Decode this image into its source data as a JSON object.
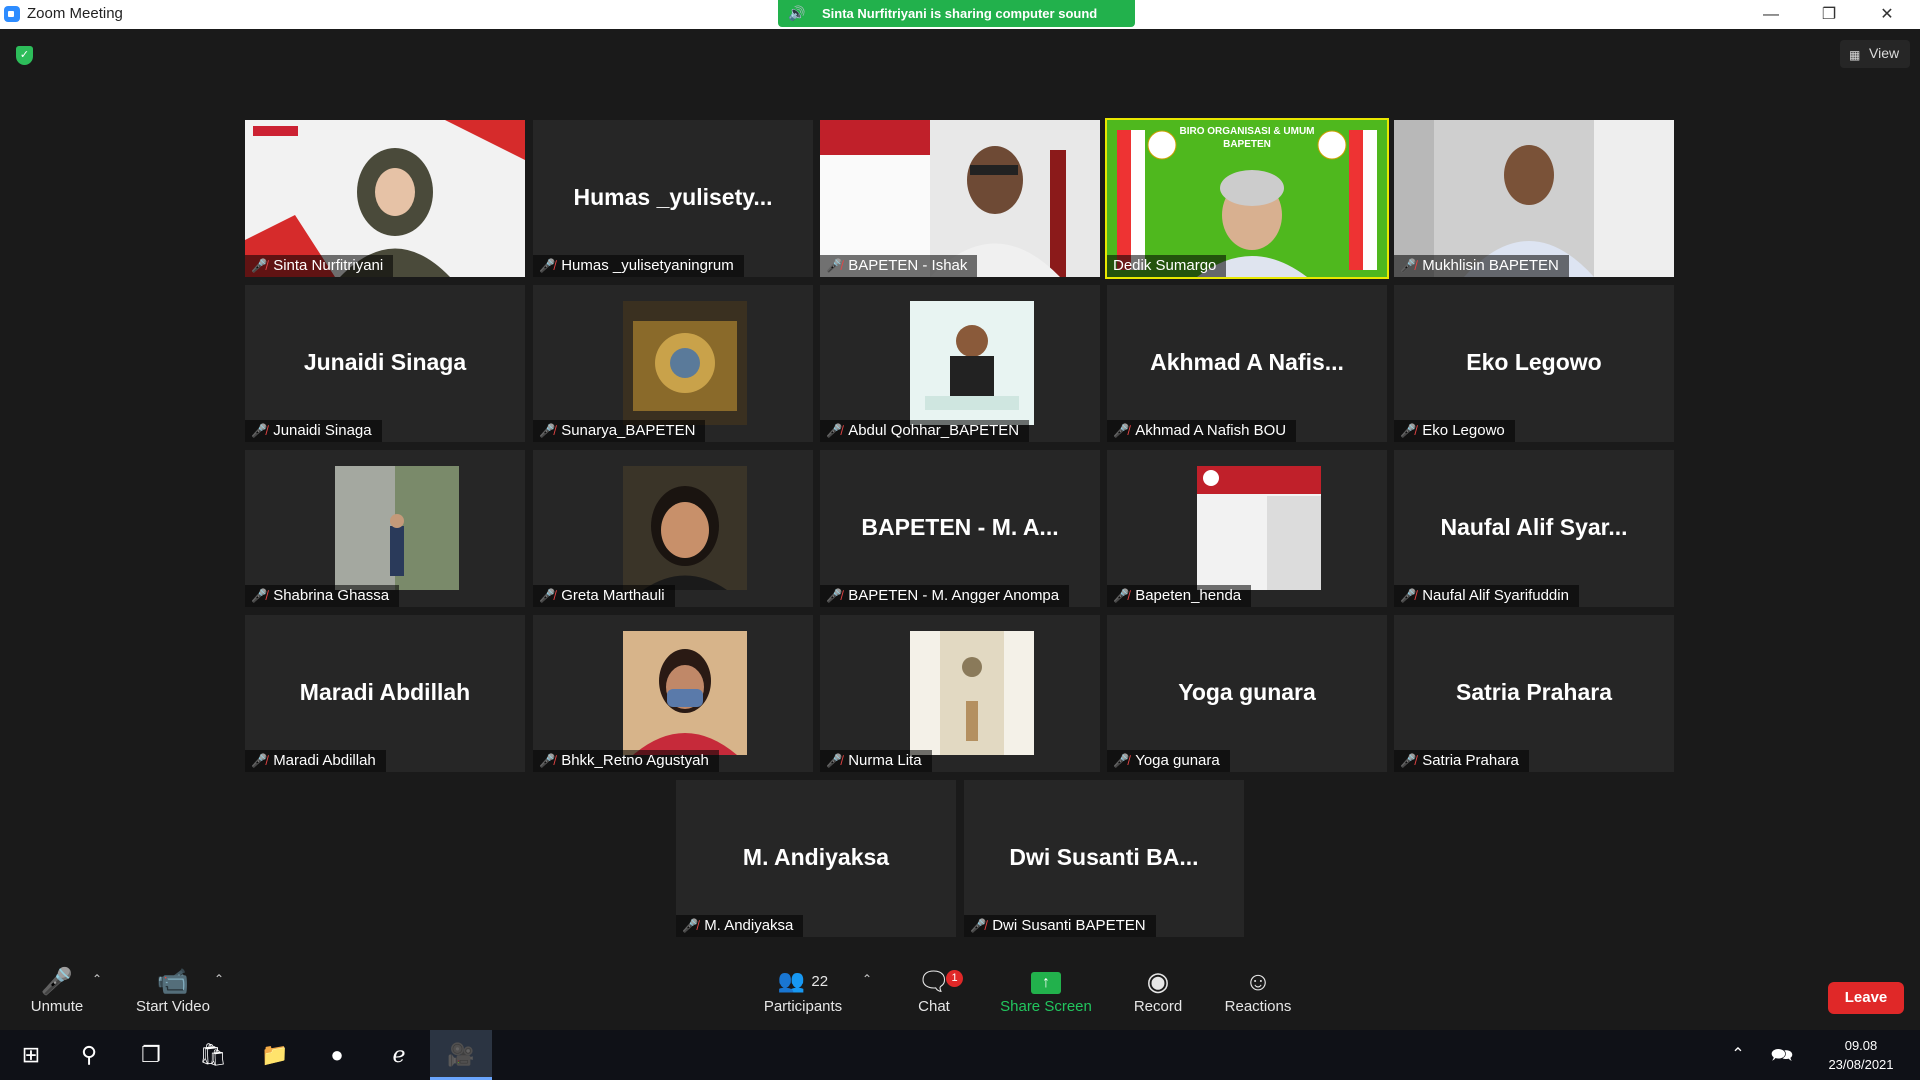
{
  "window": {
    "title": "Zoom Meeting"
  },
  "banner": {
    "text": "Sinta Nurfitriyani is sharing computer sound"
  },
  "view_label": "View",
  "tiles": [
    {
      "big": "",
      "label": "Sinta Nurfitriyani",
      "kind": "video",
      "active": false
    },
    {
      "big": "Humas _yulisety...",
      "label": "Humas _yulisetyaningrum",
      "kind": "name",
      "active": false
    },
    {
      "big": "",
      "label": "BAPETEN - Ishak",
      "kind": "video",
      "active": false
    },
    {
      "big": "",
      "label": "Dedik Sumargo",
      "kind": "video",
      "active": true,
      "overlay": "BIRO ORGANISASI & UMUM",
      "overlay2": "BAPETEN"
    },
    {
      "big": "",
      "label": "Mukhlisin BAPETEN",
      "kind": "video",
      "active": false
    },
    {
      "big": "Junaidi Sinaga",
      "label": "Junaidi Sinaga",
      "kind": "name"
    },
    {
      "big": "",
      "label": "Sunarya_BAPETEN",
      "kind": "thumb"
    },
    {
      "big": "",
      "label": "Abdul Qohhar_BAPETEN",
      "kind": "thumb"
    },
    {
      "big": "Akhmad A Nafis...",
      "label": "Akhmad A Nafish BOU",
      "kind": "name"
    },
    {
      "big": "Eko Legowo",
      "label": "Eko Legowo",
      "kind": "name"
    },
    {
      "big": "",
      "label": "Shabrina Ghassa",
      "kind": "thumb"
    },
    {
      "big": "",
      "label": "Greta Marthauli",
      "kind": "thumb"
    },
    {
      "big": "BAPETEN - M. A...",
      "label": "BAPETEN - M. Angger Anompa",
      "kind": "name"
    },
    {
      "big": "",
      "label": "Bapeten_henda",
      "kind": "thumb"
    },
    {
      "big": "Naufal Alif Syar...",
      "label": "Naufal Alif Syarifuddin",
      "kind": "name"
    },
    {
      "big": "Maradi Abdillah",
      "label": "Maradi Abdillah",
      "kind": "name"
    },
    {
      "big": "",
      "label": "Bhkk_Retno Agustyah",
      "kind": "thumb"
    },
    {
      "big": "",
      "label": "Nurma Lita",
      "kind": "thumb"
    },
    {
      "big": "Yoga gunara",
      "label": "Yoga gunara",
      "kind": "name"
    },
    {
      "big": "Satria Prahara",
      "label": "Satria Prahara",
      "kind": "name"
    },
    {
      "big": "M. Andiyaksa",
      "label": "M. Andiyaksa",
      "kind": "name"
    },
    {
      "big": "Dwi Susanti BA...",
      "label": "Dwi Susanti BAPETEN",
      "kind": "name"
    }
  ],
  "toolbar": {
    "unmute": "Unmute",
    "start_video": "Start Video",
    "participants": "Participants",
    "participant_count": "22",
    "chat": "Chat",
    "chat_badge": "1",
    "share_screen": "Share Screen",
    "record": "Record",
    "reactions": "Reactions",
    "leave": "Leave"
  },
  "colors": {
    "share_green": "#22b14c",
    "leave_red": "#e02828",
    "active_speaker": "#e8e800",
    "muted_red": "#e84545"
  },
  "taskbar": {
    "time": "09.08",
    "date": "23/08/2021"
  }
}
